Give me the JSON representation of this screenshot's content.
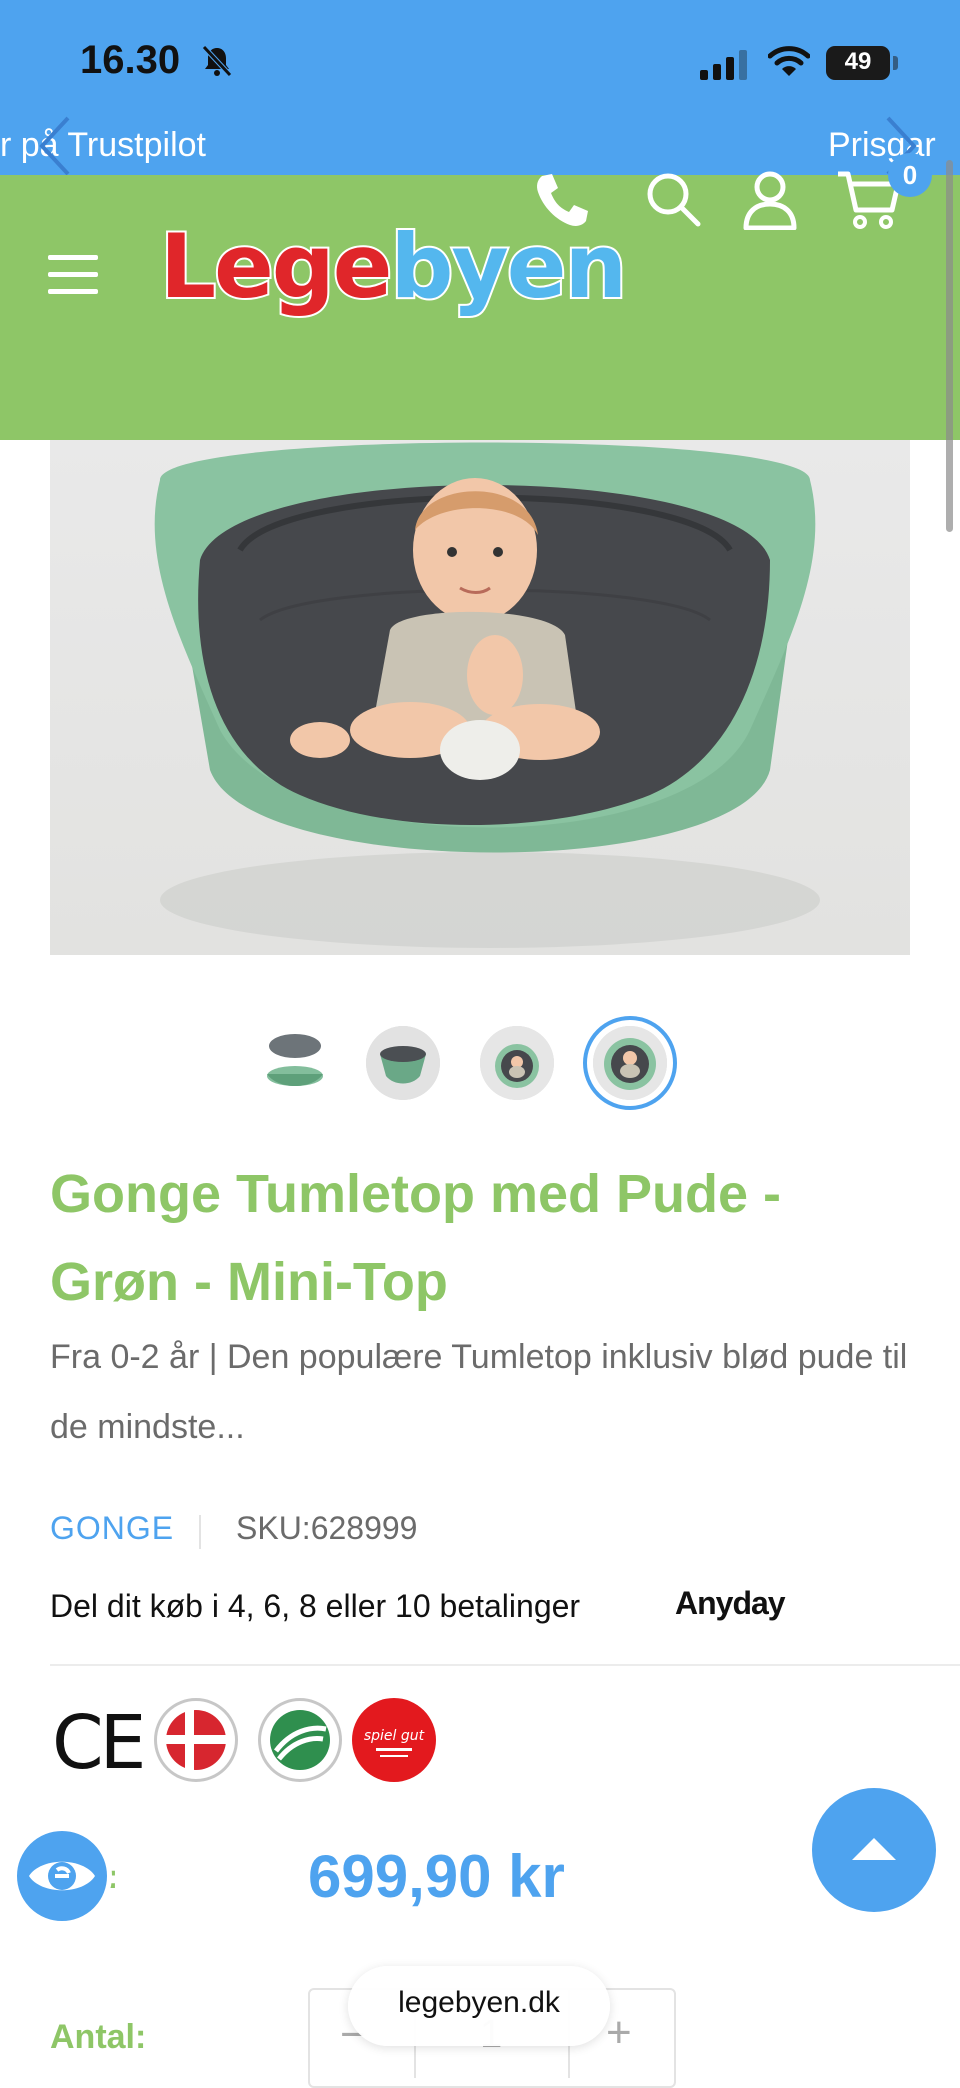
{
  "status_bar": {
    "time": "16.30",
    "battery": "49"
  },
  "announcement": {
    "left_text": "r på Trustpilot",
    "right_text": "Prisgar"
  },
  "header": {
    "logo_part1": "Lege",
    "logo_part2": "byen",
    "cart_count": "0"
  },
  "product": {
    "title": "Gonge Tumletop med Pude - Grøn - Mini-Top",
    "description": "Fra 0-2 år | Den populære Tumletop inklusiv blød pude til de mindste...",
    "brand": "GONGE",
    "sku": "SKU:628999",
    "installment_text": "Del dit køb i 4, 6, 8 eller 10 betalinger",
    "installment_provider": "Anyday",
    "price_label": "s:",
    "price": "699,90 kr",
    "quantity_label": "Antal:",
    "quantity_value": "1",
    "quantity_minus": "−",
    "quantity_plus": "+",
    "active_thumbnail": 4
  },
  "certifications": [
    "CE",
    "Made in Denmark",
    "Nordic Swan Ecolabel",
    "Spiel gut"
  ],
  "browser": {
    "url": "legebyen.dk"
  },
  "colors": {
    "primary_blue": "#4ea3ef",
    "header_green": "#8ec667",
    "logo_red": "#e0262a",
    "logo_blue": "#54b7ee"
  }
}
